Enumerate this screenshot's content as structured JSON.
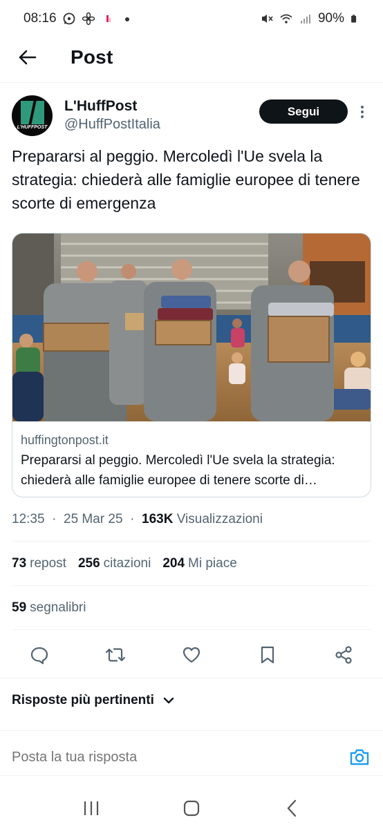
{
  "status_bar": {
    "time": "08:16",
    "battery": "90%"
  },
  "topbar": {
    "title": "Post"
  },
  "author": {
    "name": "L'HuffPost",
    "handle": "@HuffPostItalia",
    "avatar_logo_text": "L'HUFFPOST",
    "follow_label": "Segui"
  },
  "post": {
    "text": "Prepararsi al peggio. Mercoledì l'Ue svela la strategia: chiederà alle famiglie europee di tenere scorte di emergenza"
  },
  "link_card": {
    "domain": "huffingtonpost.it",
    "title": "Prepararsi al peggio. Mercoledì l'Ue svela la strategia: chiederà alle famiglie europee di tenere scorte di emergenza"
  },
  "meta": {
    "time": "12:35",
    "date": "25 Mar 25",
    "views_count": "163K",
    "views_label": "Visualizzazioni"
  },
  "stats": {
    "reposts_count": "73",
    "reposts_label": "repost",
    "quotes_count": "256",
    "quotes_label": "citazioni",
    "likes_count": "204",
    "likes_label": "Mi piace",
    "bookmarks_count": "59",
    "bookmarks_label": "segnalibri"
  },
  "actions": [
    "reply-icon",
    "repost-icon",
    "like-icon",
    "bookmark-icon",
    "share-icon"
  ],
  "replies": {
    "sort_label": "Risposte più pertinenti",
    "reply_placeholder": "Posta la tua risposta"
  },
  "colors": {
    "accent": "#1d9bf0",
    "text": "#0f1419",
    "secondary": "#536471",
    "border": "#cfd9de"
  }
}
